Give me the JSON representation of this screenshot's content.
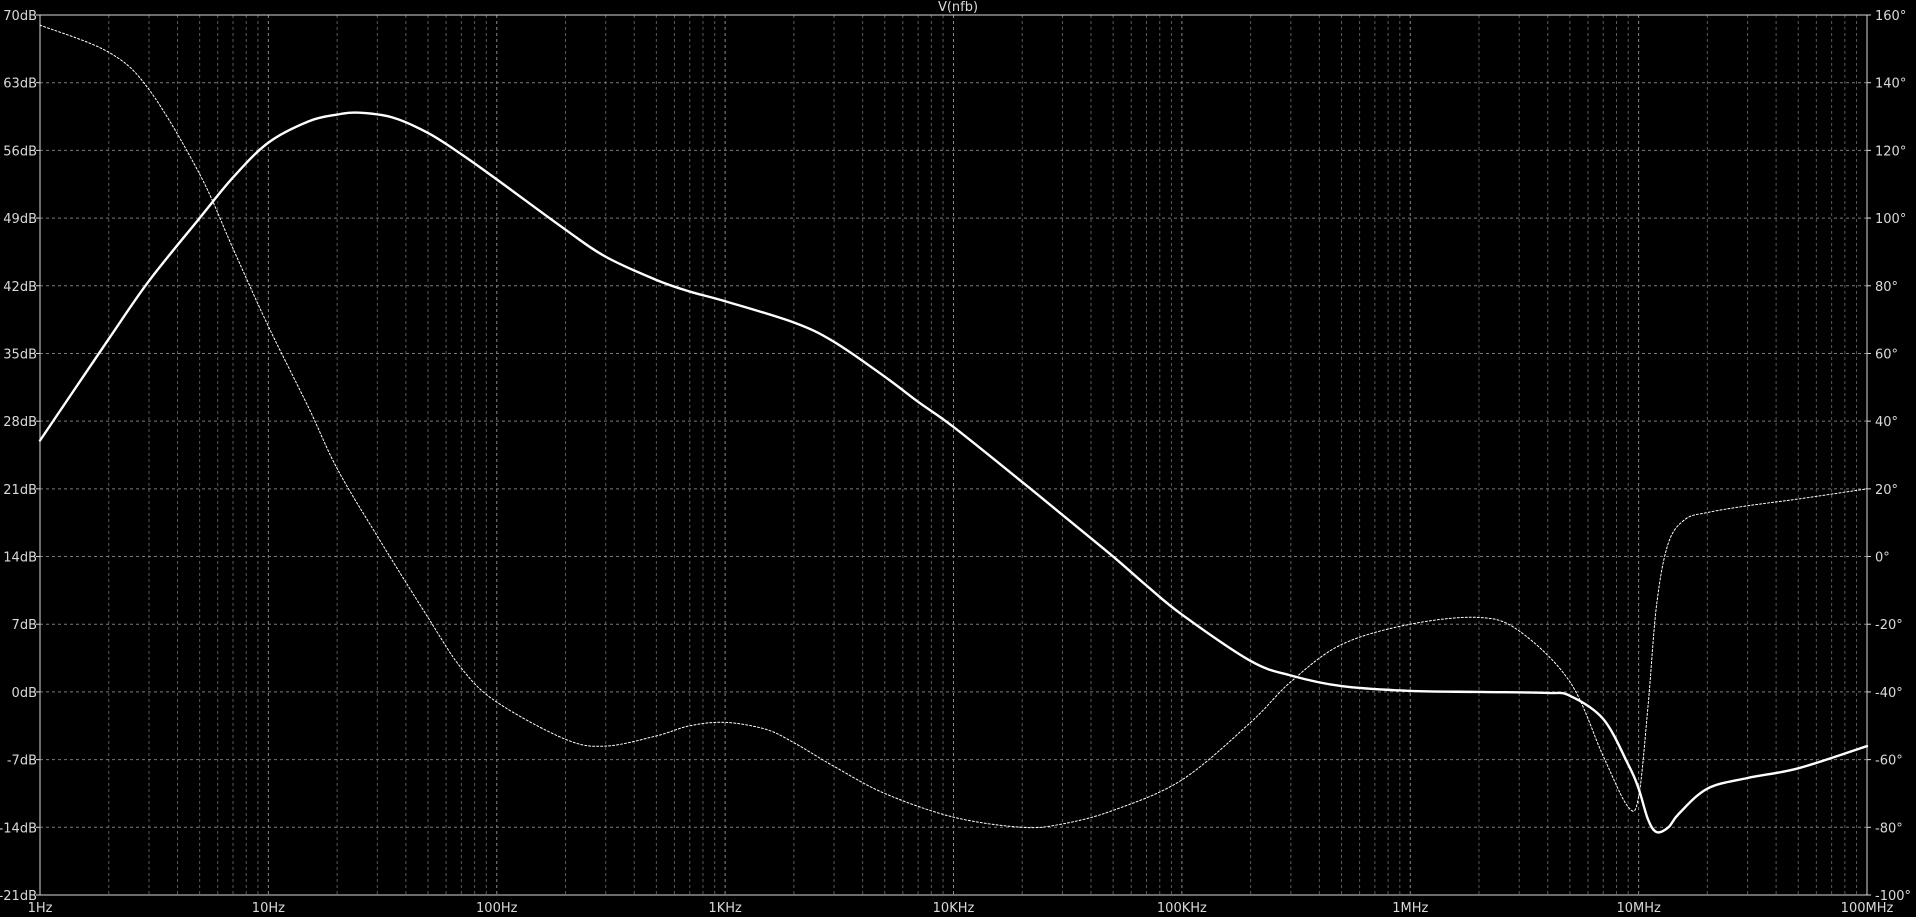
{
  "chart_data": {
    "type": "line",
    "title": "V(nfb)",
    "x_scale": "log",
    "x_range_hz": [
      1,
      100000000
    ],
    "x_tick_values": [
      1,
      10,
      100,
      1000,
      10000,
      100000,
      1000000,
      10000000,
      100000000
    ],
    "x_tick_labels": [
      "1Hz",
      "10Hz",
      "100Hz",
      "1KHz",
      "10KHz",
      "100KHz",
      "1MHz",
      "10MHz",
      "100MHz"
    ],
    "y_left": {
      "unit": "dB",
      "range": [
        -21,
        70
      ],
      "tick_values": [
        70,
        63,
        56,
        49,
        42,
        35,
        28,
        21,
        14,
        7,
        0,
        -7,
        -14,
        -21
      ],
      "tick_labels": [
        "70dB",
        "63dB",
        "56dB",
        "49dB",
        "42dB",
        "35dB",
        "28dB",
        "21dB",
        "14dB",
        "7dB",
        "0dB",
        "-7dB",
        "-14dB",
        "-21dB"
      ]
    },
    "y_right": {
      "unit": "degrees",
      "range": [
        -100,
        160
      ],
      "tick_values": [
        160,
        140,
        120,
        100,
        80,
        60,
        40,
        20,
        0,
        -20,
        -40,
        -60,
        -80,
        -100
      ],
      "tick_labels": [
        "160°",
        "140°",
        "120°",
        "100°",
        "80°",
        "60°",
        "40°",
        "20°",
        "0°",
        "-20°",
        "-40°",
        "-60°",
        "-80°",
        "-100°"
      ]
    },
    "grid": true,
    "series": [
      {
        "style": "solid",
        "axis": "left",
        "color": "#ffffff",
        "points": [
          [
            1,
            26
          ],
          [
            2,
            36.5
          ],
          [
            3,
            42.5
          ],
          [
            5,
            49
          ],
          [
            7,
            53.2
          ],
          [
            10,
            56.8
          ],
          [
            15,
            59
          ],
          [
            20,
            59.7
          ],
          [
            25,
            59.9
          ],
          [
            35,
            59.4
          ],
          [
            50,
            57.8
          ],
          [
            70,
            55.6
          ],
          [
            100,
            53
          ],
          [
            200,
            47.8
          ],
          [
            300,
            45
          ],
          [
            500,
            42.6
          ],
          [
            700,
            41.4
          ],
          [
            1000,
            40.4
          ],
          [
            2000,
            38.2
          ],
          [
            3000,
            36.2
          ],
          [
            5000,
            32.6
          ],
          [
            7000,
            30
          ],
          [
            10000,
            27.4
          ],
          [
            20000,
            21.7
          ],
          [
            30000,
            18.3
          ],
          [
            50000,
            14
          ],
          [
            70000,
            11
          ],
          [
            100000,
            8
          ],
          [
            200000,
            3.2
          ],
          [
            300000,
            1.7
          ],
          [
            500000,
            0.6
          ],
          [
            1000000,
            0.1
          ],
          [
            2000000,
            0
          ],
          [
            4000000,
            -0.1
          ],
          [
            5000000,
            -0.4
          ],
          [
            7000000,
            -2.8
          ],
          [
            9000000,
            -7.5
          ],
          [
            10000000,
            -10
          ],
          [
            11000000,
            -13.2
          ],
          [
            12000000,
            -14.5
          ],
          [
            13500000,
            -14
          ],
          [
            15000000,
            -12.6
          ],
          [
            20000000,
            -10
          ],
          [
            30000000,
            -8.9
          ],
          [
            50000000,
            -7.9
          ],
          [
            100000000,
            -5.6
          ]
        ]
      },
      {
        "style": "dashed",
        "axis": "right",
        "color": "#ffffff",
        "points": [
          [
            1,
            157
          ],
          [
            2,
            149
          ],
          [
            3,
            138
          ],
          [
            5,
            113
          ],
          [
            7,
            91
          ],
          [
            10,
            68
          ],
          [
            15,
            44
          ],
          [
            20,
            26
          ],
          [
            30,
            6
          ],
          [
            50,
            -18
          ],
          [
            70,
            -33
          ],
          [
            100,
            -43
          ],
          [
            200,
            -54
          ],
          [
            300,
            -56
          ],
          [
            500,
            -53
          ],
          [
            700,
            -50
          ],
          [
            1000,
            -49
          ],
          [
            1500,
            -51
          ],
          [
            2000,
            -55
          ],
          [
            3000,
            -62
          ],
          [
            5000,
            -70
          ],
          [
            10000,
            -77
          ],
          [
            20000,
            -80
          ],
          [
            30000,
            -79
          ],
          [
            50000,
            -75
          ],
          [
            100000,
            -66
          ],
          [
            200000,
            -49
          ],
          [
            300000,
            -37
          ],
          [
            500000,
            -26
          ],
          [
            1000000,
            -20
          ],
          [
            2000000,
            -18
          ],
          [
            3000000,
            -22
          ],
          [
            5000000,
            -37
          ],
          [
            7000000,
            -59
          ],
          [
            9000000,
            -74
          ],
          [
            10000000,
            -71
          ],
          [
            11000000,
            -44
          ],
          [
            12000000,
            -14
          ],
          [
            13500000,
            4
          ],
          [
            16000000,
            11
          ],
          [
            20000000,
            13
          ],
          [
            30000000,
            15
          ],
          [
            50000000,
            17
          ],
          [
            100000000,
            20
          ]
        ]
      }
    ]
  }
}
